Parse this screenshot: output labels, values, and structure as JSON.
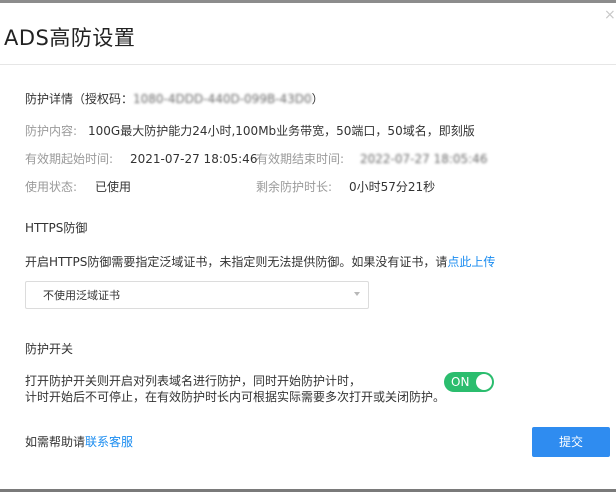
{
  "dialog": {
    "title": "ADS高防设置",
    "close_glyph": "×"
  },
  "protection": {
    "section_title_prefix": "防护详情（授权码：",
    "auth_code": "1080-4DDD-440D-099B-43D0",
    "section_title_suffix": "）",
    "content_label": "防护内容:",
    "content_value": "100G最大防护能力24小时,100Mb业务带宽，50端口，50域名，即刻版",
    "start_label": "有效期起始时间:",
    "start_value": "2021-07-27 18:05:46",
    "end_label": "有效期结束时间:",
    "end_value": "2022-07-27 18:05:46",
    "status_label": "使用状态:",
    "status_value": "已使用",
    "remaining_label": "剩余防护时长:",
    "remaining_value": "0小时57分21秒"
  },
  "https": {
    "section_title": "HTTPS防御",
    "description": "开启HTTPS防御需要指定泛域证书，未指定则无法提供防御。如果没有证书，请",
    "upload_link": "点此上传",
    "select_value": "不使用泛域证书"
  },
  "switch": {
    "section_title": "防护开关",
    "description_line1": "打开防护开关则开启对列表域名进行防护，同时开始防护计时，",
    "description_line2": "计时开始后不可停止，在有效防护时长内可根据实际需要多次打开或关闭防护。",
    "toggle_label": "ON",
    "toggle_state": "on"
  },
  "footer": {
    "help_prefix": "如需帮助请",
    "help_link": "联系客服",
    "submit_label": "提交"
  },
  "colors": {
    "accent_blue": "#2f8cf0",
    "link_blue": "#1a8cf0",
    "toggle_green": "#2bbd6e"
  }
}
